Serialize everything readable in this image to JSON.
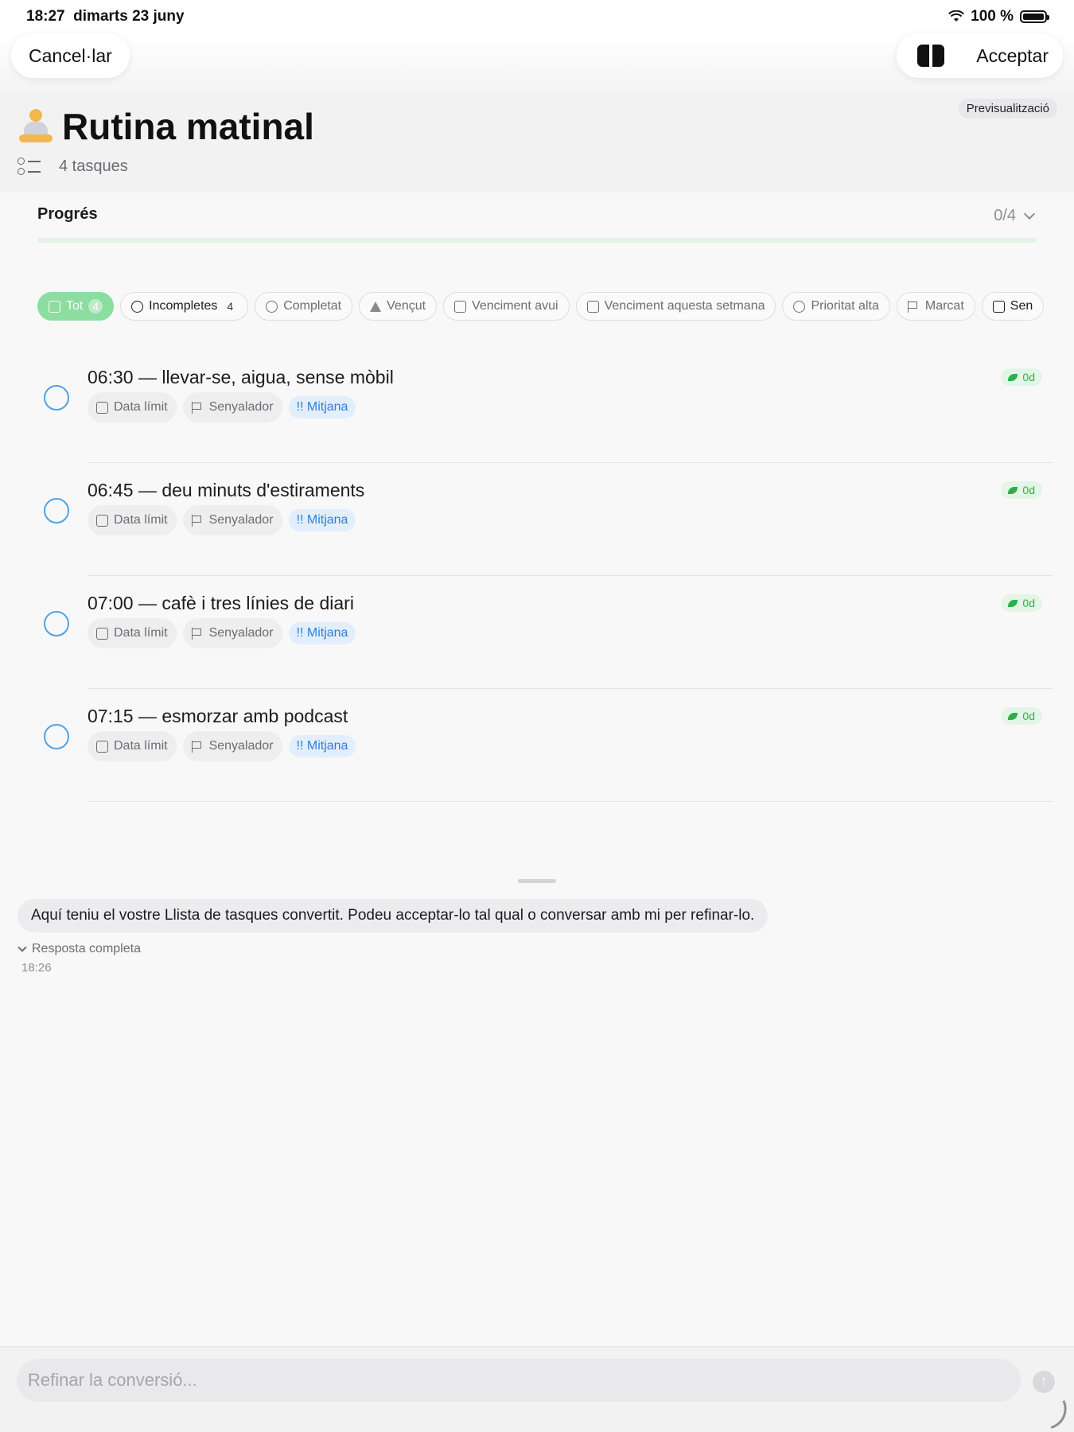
{
  "status_bar": {
    "time": "18:27",
    "date": "dimarts 23 juny",
    "battery": "100 %"
  },
  "top_bar": {
    "cancel_label": "Cancel·lar",
    "accept_label": "Acceptar"
  },
  "header": {
    "preview_badge": "Previsualització",
    "title": "Rutina matinal",
    "task_count": "4 tasques",
    "icon": "person-meditating-emoji"
  },
  "progress": {
    "label": "Progrés",
    "value": "0/4",
    "fraction": 0
  },
  "filters": [
    {
      "label": "Tot",
      "count": "4",
      "icon": "tray-icon",
      "active": true
    },
    {
      "label": "Incompletes",
      "count": "4",
      "icon": "circle-icon"
    },
    {
      "label": "Completat",
      "icon": "check-circle-icon"
    },
    {
      "label": "Vençut",
      "icon": "warning-icon"
    },
    {
      "label": "Venciment avui",
      "icon": "calendar-icon"
    },
    {
      "label": "Venciment aquesta setmana",
      "icon": "calendar-icon"
    },
    {
      "label": "Prioritat alta",
      "icon": "arrow-up-circle-icon"
    },
    {
      "label": "Marcat",
      "icon": "flag-icon"
    },
    {
      "label": "Sen",
      "icon": "calendar-clock-icon"
    }
  ],
  "tasks": [
    {
      "title": "06:30 — llevar-se, aigua, sense mòbil",
      "due_label": "Data límit",
      "flag_label": "Senyalador",
      "priority": "!! Mitjana",
      "age": "0d"
    },
    {
      "title": "06:45 — deu minuts d'estiraments",
      "due_label": "Data límit",
      "flag_label": "Senyalador",
      "priority": "!! Mitjana",
      "age": "0d"
    },
    {
      "title": "07:00 — cafè i tres línies de diari",
      "due_label": "Data límit",
      "flag_label": "Senyalador",
      "priority": "!! Mitjana",
      "age": "0d"
    },
    {
      "title": "07:15 — esmorzar amb podcast",
      "due_label": "Data límit",
      "flag_label": "Senyalador",
      "priority": "!! Mitjana",
      "age": "0d"
    }
  ],
  "chat": {
    "message": "Aquí teniu el vostre Llista de tasques convertit. Podeu acceptar-lo tal qual o conversar amb mi per refinar-lo.",
    "response_toggle": "Resposta completa",
    "time": "18:26"
  },
  "input": {
    "placeholder": "Refinar la conversió..."
  },
  "colors": {
    "accent_green": "#34c759",
    "check_blue": "#4da3e8",
    "priority_blue": "#2f7fd6"
  }
}
